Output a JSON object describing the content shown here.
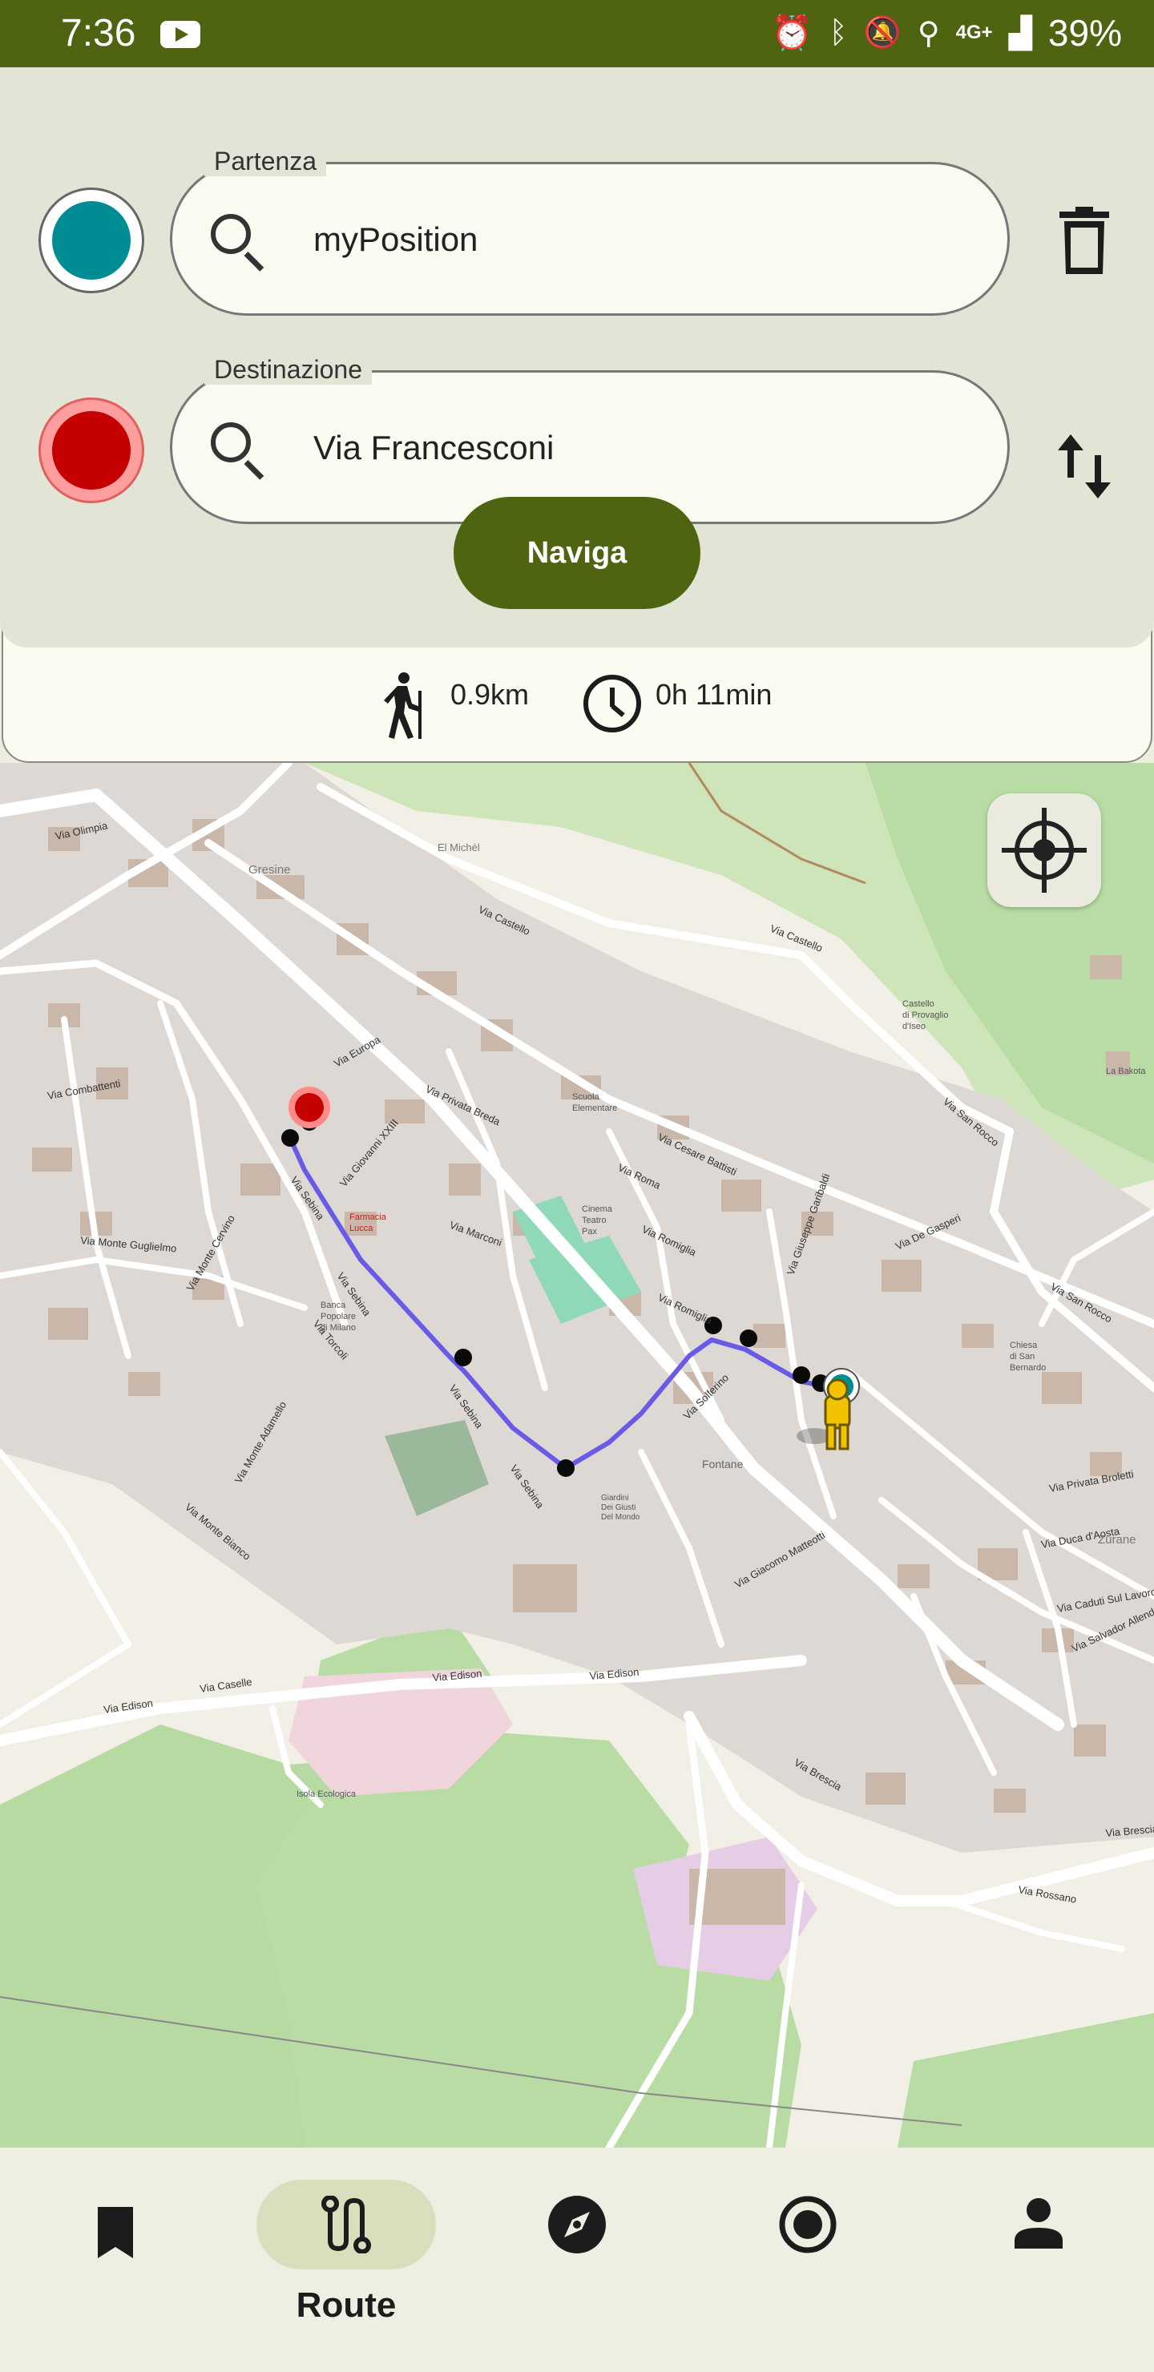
{
  "status_bar": {
    "time": "7:36",
    "network": "4G+",
    "battery": "39%"
  },
  "route_form": {
    "start_label": "Partenza",
    "start_value": "myPosition",
    "destination_label": "Destinazione",
    "destination_value": "Via Francesconi",
    "navigate_button": "Naviga"
  },
  "route_summary": {
    "distance": "0.9km",
    "duration": "0h 11min"
  },
  "map": {
    "street_labels": [
      "Via Olimpia",
      "Via Castello",
      "Via Roma",
      "Via Sebina",
      "Via Romiglia",
      "Via Solferino",
      "Via Edison",
      "Via Brescia",
      "Via Caselle",
      "Via Monte Guglielmo",
      "Via Cesare Battisti",
      "Via San Rocco",
      "Via De Gasperi",
      "Via Giuseppe Garibaldi",
      "Via Duca d'Aosta",
      "Via Giacomo Matteotti",
      "Via Rossano",
      "Via Europa",
      "Via Marconi",
      "Via Combattenti",
      "Via Torcoli",
      "Via Monte Bianco",
      "Via Monte Cervino",
      "Via Monte Adamello",
      "Via Privata Broletti",
      "Via Caduti Sul Lavoro",
      "Via Salvador Allende",
      "Via Privata Breda",
      "Via Giovanni XXIII"
    ],
    "place_labels": [
      "Gresine",
      "Fontane",
      "Zurane",
      "La Bakota",
      "El Michèl",
      "Castello di Provaglio d'Iseo",
      "Chiesa di San Bernardo",
      "Farmacia Lucca",
      "Banca Popolare di Milano",
      "Scuola Elementare",
      "Cinema Teatro Pax",
      "Giardini Dei Giusti Del Mondo",
      "Isola Ecologica"
    ],
    "route_color": "#6a5be6",
    "accent_color": "#4f6410"
  },
  "bottom_nav": {
    "items": [
      {
        "name": "bookmark",
        "label": ""
      },
      {
        "name": "route",
        "label": "Route",
        "active": true
      },
      {
        "name": "explore",
        "label": ""
      },
      {
        "name": "record",
        "label": ""
      },
      {
        "name": "profile",
        "label": ""
      }
    ]
  }
}
